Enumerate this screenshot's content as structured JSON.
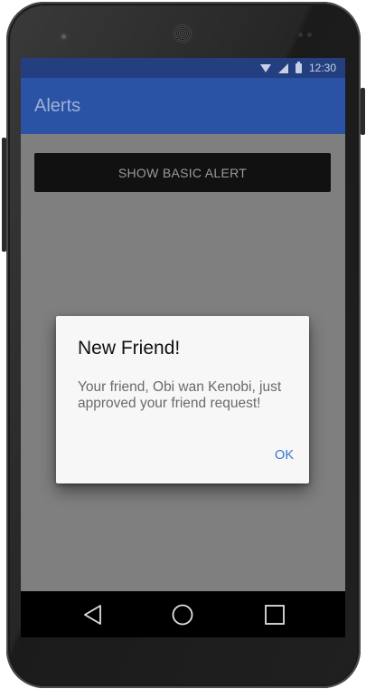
{
  "status_bar": {
    "time": "12:30"
  },
  "app_bar": {
    "title": "Alerts"
  },
  "main": {
    "show_alert_button": "SHOW BASIC ALERT"
  },
  "dialog": {
    "title": "New Friend!",
    "message": "Your friend, Obi wan Kenobi, just approved your friend request!",
    "ok_button": "OK"
  },
  "nav_bar": {
    "icons": [
      "back-icon",
      "home-icon",
      "recents-icon"
    ]
  },
  "colors": {
    "status_bar": "#233f80",
    "app_bar": "#2a53a6",
    "dialog_action": "#3b73d6",
    "scrim_background": "#7f7f7f"
  }
}
